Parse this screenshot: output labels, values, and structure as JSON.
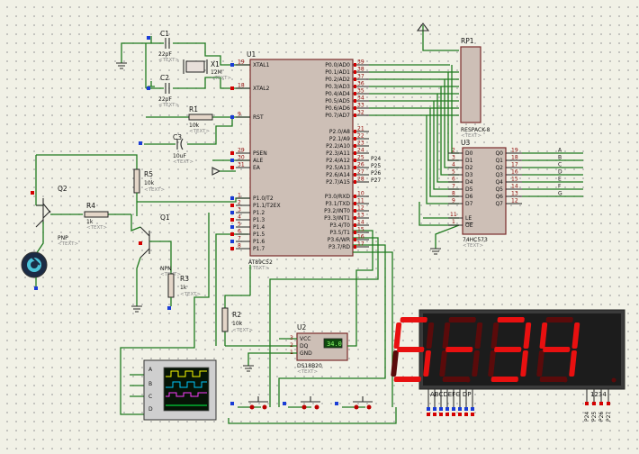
{
  "mcu": {
    "ref": "U1",
    "part": "AT89C52",
    "left_pins": [
      "XTAL1",
      "XTAL2",
      "RST",
      "PSEN",
      "ALE",
      "EA",
      "P1.0/T2",
      "P1.1/T2EX",
      "P1.2",
      "P1.3",
      "P1.4",
      "P1.5",
      "P1.6",
      "P1.7"
    ],
    "left_nums": [
      "19",
      "18",
      "9",
      "29",
      "30",
      "31",
      "1",
      "2",
      "3",
      "4",
      "5",
      "6",
      "7",
      "8"
    ],
    "right_pins": [
      "P0.0/AD0",
      "P0.1/AD1",
      "P0.2/AD2",
      "P0.3/AD3",
      "P0.4/AD4",
      "P0.5/AD5",
      "P0.6/AD6",
      "P0.7/AD7",
      "P2.0/A8",
      "P2.1/A9",
      "P2.2/A10",
      "P2.3/A11",
      "P2.4/A12",
      "P2.5/A13",
      "P2.6/A14",
      "P2.7/A15",
      "P3.0/RXD",
      "P3.1/TXD",
      "P3.2/INT0",
      "P3.3/INT1",
      "P3.4/T0",
      "P3.5/T1",
      "P3.6/WR",
      "P3.7/RD"
    ],
    "right_nums": [
      "39",
      "38",
      "37",
      "36",
      "35",
      "34",
      "33",
      "32",
      "21",
      "22",
      "23",
      "24",
      "25",
      "26",
      "27",
      "28",
      "10",
      "11",
      "12",
      "13",
      "14",
      "15",
      "16",
      "17"
    ],
    "net_labels": [
      "P24",
      "P25",
      "P26",
      "P27"
    ]
  },
  "crystal": {
    "ref": "X1",
    "value": "12M"
  },
  "caps": [
    {
      "ref": "C1",
      "value": "22pF"
    },
    {
      "ref": "C2",
      "value": "22pF"
    },
    {
      "ref": "C3",
      "value": "10uF"
    }
  ],
  "resistors": [
    {
      "ref": "R1",
      "value": "10k"
    },
    {
      "ref": "R5",
      "value": "10k"
    },
    {
      "ref": "R4",
      "value": "1k"
    },
    {
      "ref": "R3",
      "value": "1k"
    },
    {
      "ref": "R2",
      "value": "10k"
    }
  ],
  "transistors": [
    {
      "ref": "Q2",
      "type": "PNP"
    },
    {
      "ref": "Q1",
      "type": "NPN"
    }
  ],
  "text_placeholder": "<TEXT>",
  "rpack": {
    "ref": "RP1",
    "part": "RESPACK-8"
  },
  "latch": {
    "ref": "U3",
    "part": "74HC573",
    "d_pins": [
      "D0",
      "D1",
      "D2",
      "D3",
      "D4",
      "D5",
      "D6",
      "D7"
    ],
    "d_nums": [
      "2",
      "3",
      "4",
      "5",
      "6",
      "7",
      "8",
      "9"
    ],
    "q_pins": [
      "Q0",
      "Q1",
      "Q2",
      "Q3",
      "Q4",
      "Q5",
      "Q6",
      "Q7"
    ],
    "q_nums": [
      "19",
      "18",
      "17",
      "16",
      "15",
      "14",
      "13",
      "12"
    ],
    "le": "LE",
    "oe": "OE",
    "le_num": "11",
    "oe_num": "1",
    "outputs": [
      "A",
      "B",
      "C",
      "D",
      "E",
      "F",
      "G"
    ]
  },
  "sensor": {
    "ref": "U2",
    "part": "DS18B20",
    "pins": [
      "VCC",
      "DQ",
      "GND"
    ],
    "pin_nums": [
      "3",
      "2",
      "1"
    ],
    "reading": "34.0"
  },
  "scope": {
    "channels": [
      "A",
      "B",
      "C",
      "D"
    ]
  },
  "display": {
    "digits": [
      "5",
      "-",
      "3",
      "4"
    ],
    "seg_label": "ABCDEFG  DP",
    "dig_label": "1234",
    "pin_labels": [
      "P24",
      "P25",
      "P26",
      "P27"
    ]
  },
  "colors": {
    "wire": "#1f7a1f",
    "segment": "#e81010",
    "chip": "#cdbfb6"
  }
}
